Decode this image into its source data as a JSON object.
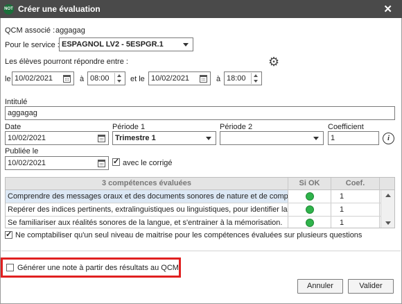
{
  "window": {
    "app_badge": "NOT",
    "title": "Créer une évaluation"
  },
  "qcm": {
    "label": "QCM associé :",
    "value": "aggagag"
  },
  "service": {
    "label": "Pour le service :",
    "value": "ESPAGNOL LV2 - 5ESPGR.1"
  },
  "window_period": {
    "label": "Les élèves pourront répondre entre :",
    "from_prefix": "le",
    "from_date": "10/02/2021",
    "at1": "à",
    "from_time": "08:00",
    "and": "et le",
    "to_date": "10/02/2021",
    "at2": "à",
    "to_time": "18:00"
  },
  "intitule": {
    "label": "Intitulé",
    "value": "aggagag"
  },
  "date": {
    "label": "Date",
    "value": "10/02/2021"
  },
  "periode1": {
    "label": "Période 1",
    "value": "Trimestre 1"
  },
  "periode2": {
    "label": "Période 2",
    "value": ""
  },
  "coefficient": {
    "label": "Coefficient",
    "value": "1"
  },
  "publiee": {
    "label": "Publiée le",
    "value": "10/02/2021",
    "avec_corrige_label": "avec le corrigé",
    "avec_corrige_checked": true
  },
  "competences": {
    "header": "3 compétences évaluées",
    "col_siok": "Si OK",
    "col_coef": "Coef.",
    "rows": [
      {
        "label": "Comprendre des messages oraux et des documents sonores de nature et de comple",
        "coef": "1"
      },
      {
        "label": "Repérer des indices pertinents, extralinguistiques ou linguistiques, pour identifier la s",
        "coef": "1"
      },
      {
        "label": "Se familiariser aux réalités sonores de la langue, et s'entrainer à la mémorisation.",
        "coef": "1"
      }
    ],
    "status_color": "#2fb34b"
  },
  "options": {
    "single_level_label": "Ne comptabiliser qu'un seul niveau de maitrise pour les compétences évaluées sur plusieurs questions",
    "single_level_checked": true,
    "generate_note_label": "Générer une note à partir des résultats au QCM",
    "generate_note_checked": false
  },
  "buttons": {
    "cancel": "Annuler",
    "validate": "Valider"
  },
  "colors": {
    "titlebar": "#4a4a4a",
    "highlight_box": "#e02020",
    "selected_row": "#dce8f5"
  }
}
